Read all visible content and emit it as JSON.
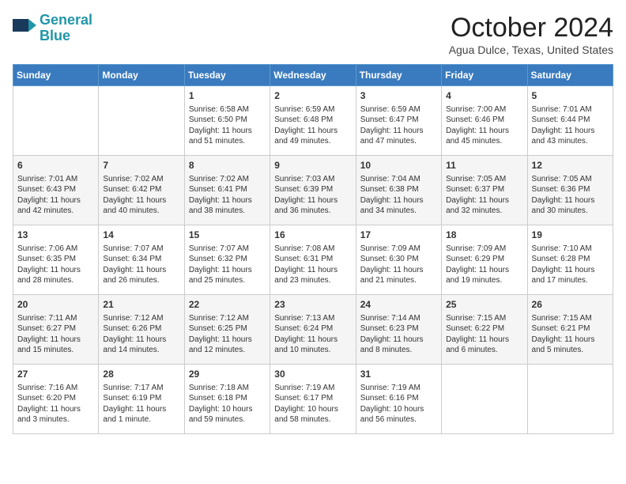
{
  "header": {
    "logo_line1": "General",
    "logo_line2": "Blue",
    "month": "October 2024",
    "location": "Agua Dulce, Texas, United States"
  },
  "days_of_week": [
    "Sunday",
    "Monday",
    "Tuesday",
    "Wednesday",
    "Thursday",
    "Friday",
    "Saturday"
  ],
  "weeks": [
    [
      {
        "day": "",
        "info": ""
      },
      {
        "day": "",
        "info": ""
      },
      {
        "day": "1",
        "info": "Sunrise: 6:58 AM\nSunset: 6:50 PM\nDaylight: 11 hours and 51 minutes."
      },
      {
        "day": "2",
        "info": "Sunrise: 6:59 AM\nSunset: 6:48 PM\nDaylight: 11 hours and 49 minutes."
      },
      {
        "day": "3",
        "info": "Sunrise: 6:59 AM\nSunset: 6:47 PM\nDaylight: 11 hours and 47 minutes."
      },
      {
        "day": "4",
        "info": "Sunrise: 7:00 AM\nSunset: 6:46 PM\nDaylight: 11 hours and 45 minutes."
      },
      {
        "day": "5",
        "info": "Sunrise: 7:01 AM\nSunset: 6:44 PM\nDaylight: 11 hours and 43 minutes."
      }
    ],
    [
      {
        "day": "6",
        "info": "Sunrise: 7:01 AM\nSunset: 6:43 PM\nDaylight: 11 hours and 42 minutes."
      },
      {
        "day": "7",
        "info": "Sunrise: 7:02 AM\nSunset: 6:42 PM\nDaylight: 11 hours and 40 minutes."
      },
      {
        "day": "8",
        "info": "Sunrise: 7:02 AM\nSunset: 6:41 PM\nDaylight: 11 hours and 38 minutes."
      },
      {
        "day": "9",
        "info": "Sunrise: 7:03 AM\nSunset: 6:39 PM\nDaylight: 11 hours and 36 minutes."
      },
      {
        "day": "10",
        "info": "Sunrise: 7:04 AM\nSunset: 6:38 PM\nDaylight: 11 hours and 34 minutes."
      },
      {
        "day": "11",
        "info": "Sunrise: 7:05 AM\nSunset: 6:37 PM\nDaylight: 11 hours and 32 minutes."
      },
      {
        "day": "12",
        "info": "Sunrise: 7:05 AM\nSunset: 6:36 PM\nDaylight: 11 hours and 30 minutes."
      }
    ],
    [
      {
        "day": "13",
        "info": "Sunrise: 7:06 AM\nSunset: 6:35 PM\nDaylight: 11 hours and 28 minutes."
      },
      {
        "day": "14",
        "info": "Sunrise: 7:07 AM\nSunset: 6:34 PM\nDaylight: 11 hours and 26 minutes."
      },
      {
        "day": "15",
        "info": "Sunrise: 7:07 AM\nSunset: 6:32 PM\nDaylight: 11 hours and 25 minutes."
      },
      {
        "day": "16",
        "info": "Sunrise: 7:08 AM\nSunset: 6:31 PM\nDaylight: 11 hours and 23 minutes."
      },
      {
        "day": "17",
        "info": "Sunrise: 7:09 AM\nSunset: 6:30 PM\nDaylight: 11 hours and 21 minutes."
      },
      {
        "day": "18",
        "info": "Sunrise: 7:09 AM\nSunset: 6:29 PM\nDaylight: 11 hours and 19 minutes."
      },
      {
        "day": "19",
        "info": "Sunrise: 7:10 AM\nSunset: 6:28 PM\nDaylight: 11 hours and 17 minutes."
      }
    ],
    [
      {
        "day": "20",
        "info": "Sunrise: 7:11 AM\nSunset: 6:27 PM\nDaylight: 11 hours and 15 minutes."
      },
      {
        "day": "21",
        "info": "Sunrise: 7:12 AM\nSunset: 6:26 PM\nDaylight: 11 hours and 14 minutes."
      },
      {
        "day": "22",
        "info": "Sunrise: 7:12 AM\nSunset: 6:25 PM\nDaylight: 11 hours and 12 minutes."
      },
      {
        "day": "23",
        "info": "Sunrise: 7:13 AM\nSunset: 6:24 PM\nDaylight: 11 hours and 10 minutes."
      },
      {
        "day": "24",
        "info": "Sunrise: 7:14 AM\nSunset: 6:23 PM\nDaylight: 11 hours and 8 minutes."
      },
      {
        "day": "25",
        "info": "Sunrise: 7:15 AM\nSunset: 6:22 PM\nDaylight: 11 hours and 6 minutes."
      },
      {
        "day": "26",
        "info": "Sunrise: 7:15 AM\nSunset: 6:21 PM\nDaylight: 11 hours and 5 minutes."
      }
    ],
    [
      {
        "day": "27",
        "info": "Sunrise: 7:16 AM\nSunset: 6:20 PM\nDaylight: 11 hours and 3 minutes."
      },
      {
        "day": "28",
        "info": "Sunrise: 7:17 AM\nSunset: 6:19 PM\nDaylight: 11 hours and 1 minute."
      },
      {
        "day": "29",
        "info": "Sunrise: 7:18 AM\nSunset: 6:18 PM\nDaylight: 10 hours and 59 minutes."
      },
      {
        "day": "30",
        "info": "Sunrise: 7:19 AM\nSunset: 6:17 PM\nDaylight: 10 hours and 58 minutes."
      },
      {
        "day": "31",
        "info": "Sunrise: 7:19 AM\nSunset: 6:16 PM\nDaylight: 10 hours and 56 minutes."
      },
      {
        "day": "",
        "info": ""
      },
      {
        "day": "",
        "info": ""
      }
    ]
  ]
}
